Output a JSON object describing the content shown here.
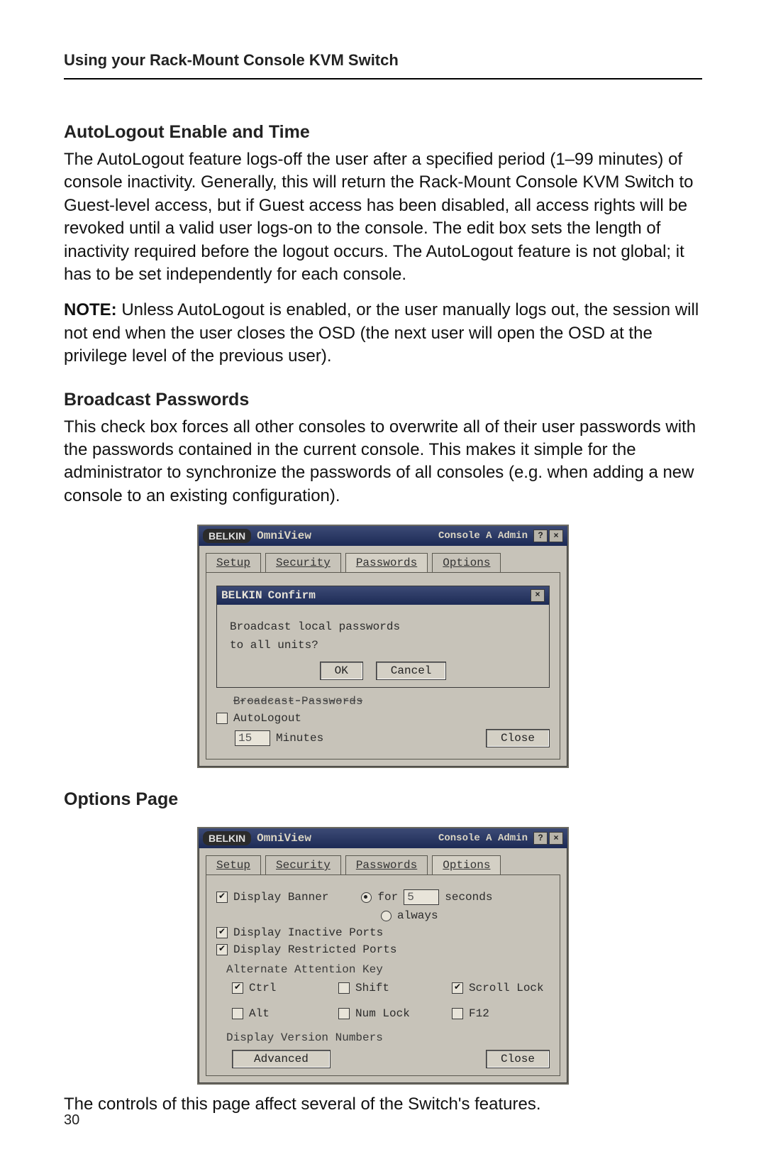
{
  "running_head": "Using your Rack-Mount Console KVM Switch",
  "page_number": "30",
  "sections": {
    "autologout": {
      "title": "AutoLogout Enable and Time",
      "para1": "The AutoLogout feature logs-off the user after a specified period (1–99 minutes) of console inactivity. Generally, this will return the Rack-Mount Console KVM Switch to Guest-level access, but if Guest access has been disabled, all access rights will be revoked until a valid user logs-on to the console. The edit box sets the length of inactivity required before the logout occurs. The AutoLogout feature is not global; it has to be set independently for each console.",
      "note_lead": "NOTE:",
      "note_rest": " Unless AutoLogout is enabled, or the user manually logs out, the session will not end when the user closes the OSD (the next user will open the OSD at the privilege level of the previous user)."
    },
    "broadcast": {
      "title": "Broadcast Passwords",
      "para1": "This check box forces all other consoles to overwrite all of their user passwords with the passwords contained in the current console. This makes it simple for the administrator to synchronize the passwords of all consoles (e.g. when adding a new console to an existing configuration)."
    },
    "options": {
      "title": "Options Page",
      "para1": "The controls of this page affect several of the Switch's features."
    }
  },
  "osd_common": {
    "brand": "BELKIN",
    "product": "OmniView",
    "console_label": "Console A  Admin",
    "tabs": [
      "Setup",
      "Security",
      "Passwords",
      "Options"
    ],
    "close_btn": "Close"
  },
  "osd_confirm": {
    "dialog_title": "Confirm",
    "line1": "Broadcast local passwords",
    "line2": "to all units?",
    "ok": "OK",
    "cancel": "Cancel",
    "under_label": "Broadcast Passwords",
    "autologout_label": "AutoLogout",
    "minutes_label": "Minutes",
    "minutes_value": "15"
  },
  "osd_options": {
    "display_banner": "Display Banner",
    "for_label": "for",
    "seconds_value": "5",
    "seconds_label": "seconds",
    "always_label": "always",
    "display_inactive": "Display Inactive Ports",
    "display_restricted": "Display Restricted Ports",
    "alt_attn_label": "Alternate Attention Key",
    "keys": {
      "ctrl": "Ctrl",
      "shift": "Shift",
      "scroll_lock": "Scroll Lock",
      "alt": "Alt",
      "num_lock": "Num Lock",
      "f12": "F12"
    },
    "display_version": "Display Version Numbers",
    "advanced": "Advanced"
  }
}
